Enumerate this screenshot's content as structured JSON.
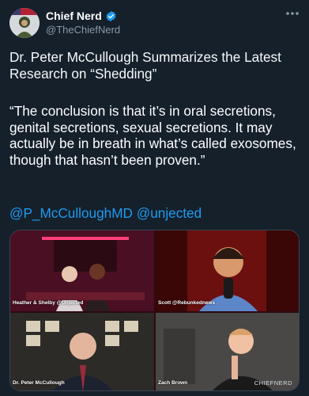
{
  "author": {
    "display_name": "Chief Nerd",
    "handle": "@TheChiefNerd",
    "avatar_icon": "avatar-icon",
    "verified_icon": "verified-badge-icon",
    "more_icon": "more-options-icon"
  },
  "tweet": {
    "title": "Dr. Peter McCullough Summarizes the Latest Research on “Shedding”",
    "quote": "“The conclusion is that it’s in oral secretions, genital secretions, sexual secretions. It may actually be in breath in what’s called exosomes, though that hasn’t been proven.”",
    "mentions": [
      "@P_McCulloughMD",
      "@unjected"
    ]
  },
  "media": {
    "tiles": [
      {
        "caption": "Heather & Shelby @Unjected"
      },
      {
        "caption": "Scott @Rebunkednews"
      },
      {
        "caption": "Dr. Peter McCullough"
      },
      {
        "caption": "Zach Brown"
      }
    ],
    "watermark": "CHIEFNERD"
  },
  "colors": {
    "background": "#15202b",
    "link": "#1d9bf0",
    "secondary_text": "#8b98a5",
    "verified": "#1d9bf0"
  }
}
